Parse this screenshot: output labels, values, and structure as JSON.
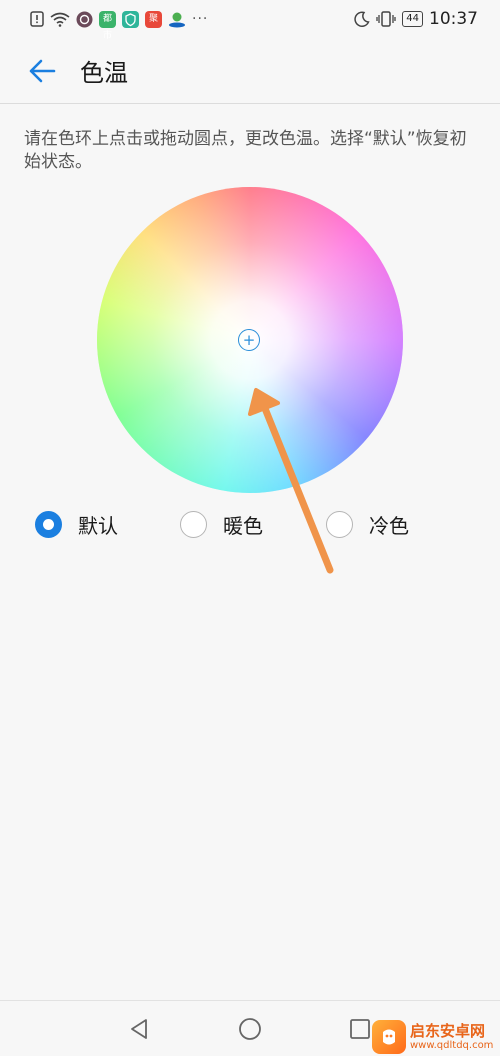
{
  "status_bar": {
    "app_badges": [
      "都市",
      "聚"
    ],
    "battery": "44",
    "time": "10:37",
    "more": "···"
  },
  "header": {
    "title": "色温"
  },
  "description": "请在色环上点击或拖动圆点，更改色温。选择“默认”恢复初始状态。",
  "wheel": {
    "handle_symbol": "+"
  },
  "options": [
    {
      "label": "默认",
      "checked": true
    },
    {
      "label": "暖色",
      "checked": false
    },
    {
      "label": "冷色",
      "checked": false
    }
  ],
  "watermark": {
    "name": "启东安卓网",
    "url": "www.qdltdq.com"
  },
  "colors": {
    "accent": "#1b7fe0",
    "annotation_arrow": "#f0944a"
  }
}
